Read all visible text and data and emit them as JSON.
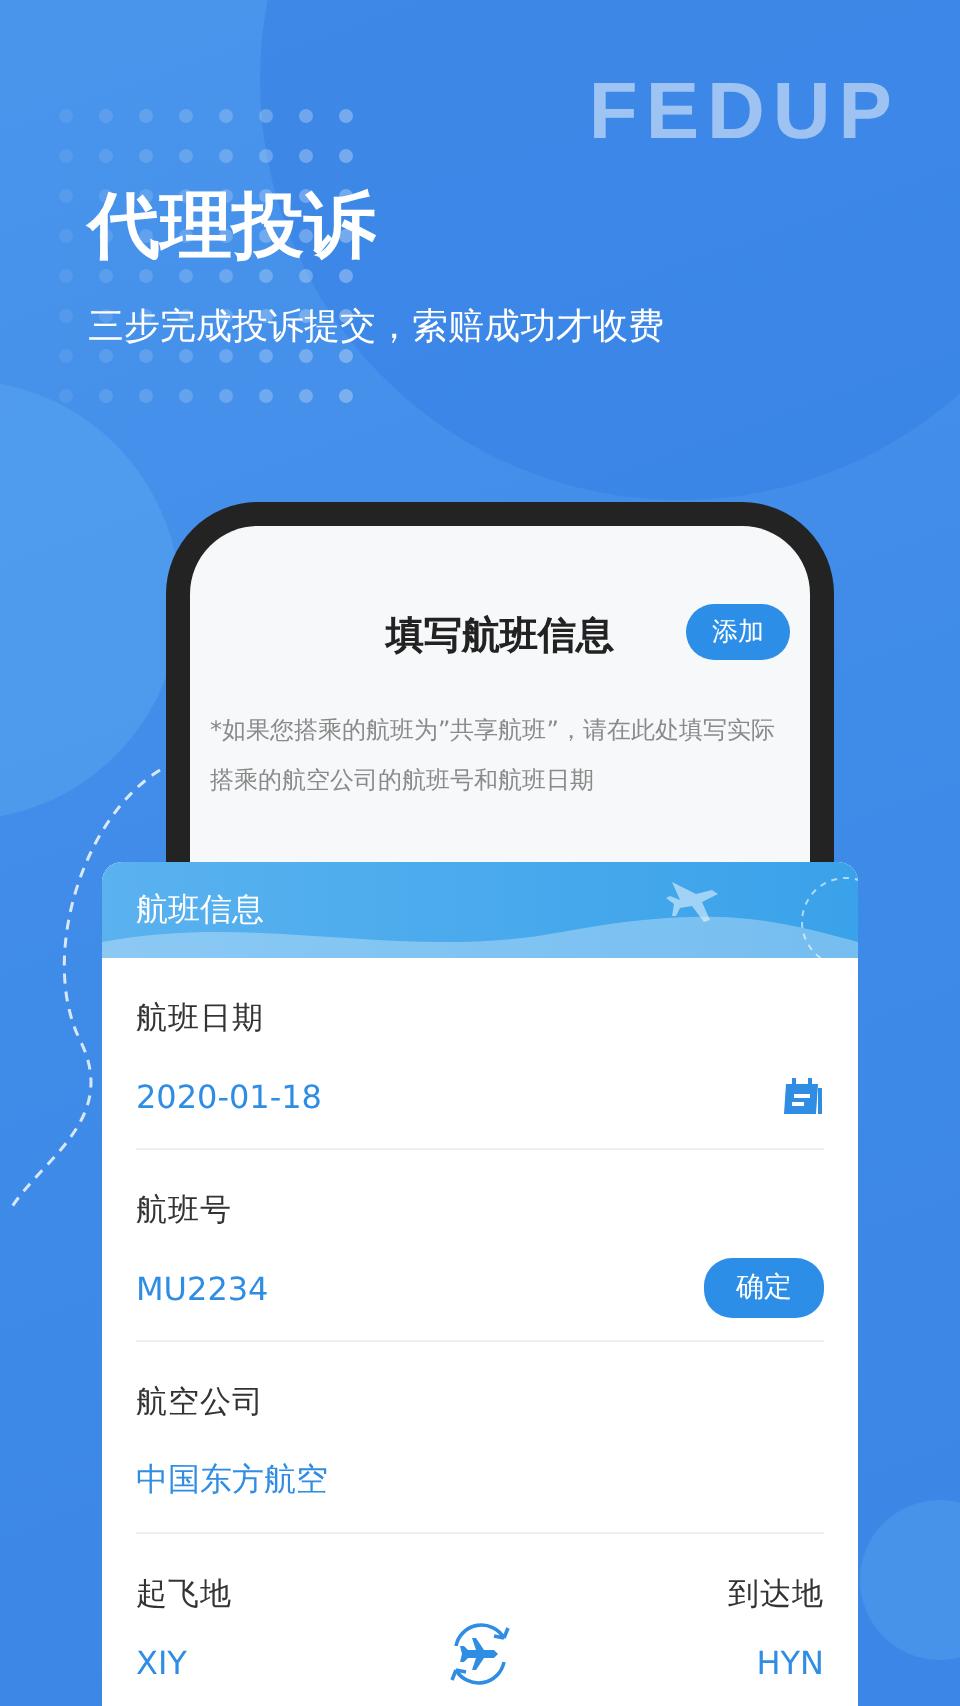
{
  "hero": {
    "brand": "FEDUP",
    "title": "代理投诉",
    "subtitle": "三步完成投诉提交，索赔成功才收费"
  },
  "phone_screen": {
    "title": "填写航班信息",
    "add_button": "添加",
    "note": "*如果您搭乘的航班为”共享航班”，请在此处填写实际搭乘的航空公司的航班号和航班日期"
  },
  "flight_card": {
    "title": "航班信息",
    "fields": [
      {
        "kind": "date",
        "label": "航班日期",
        "value": "2020-01-18"
      },
      {
        "kind": "confirm",
        "label": "航班号",
        "value": "MU2234",
        "button": "确定"
      },
      {
        "kind": "text",
        "label": "航空公司",
        "value": "中国东方航空"
      }
    ],
    "route": {
      "origin_label": "起飞地",
      "origin": "XIY",
      "destination_label": "到达地",
      "destination": "HYN"
    }
  }
}
